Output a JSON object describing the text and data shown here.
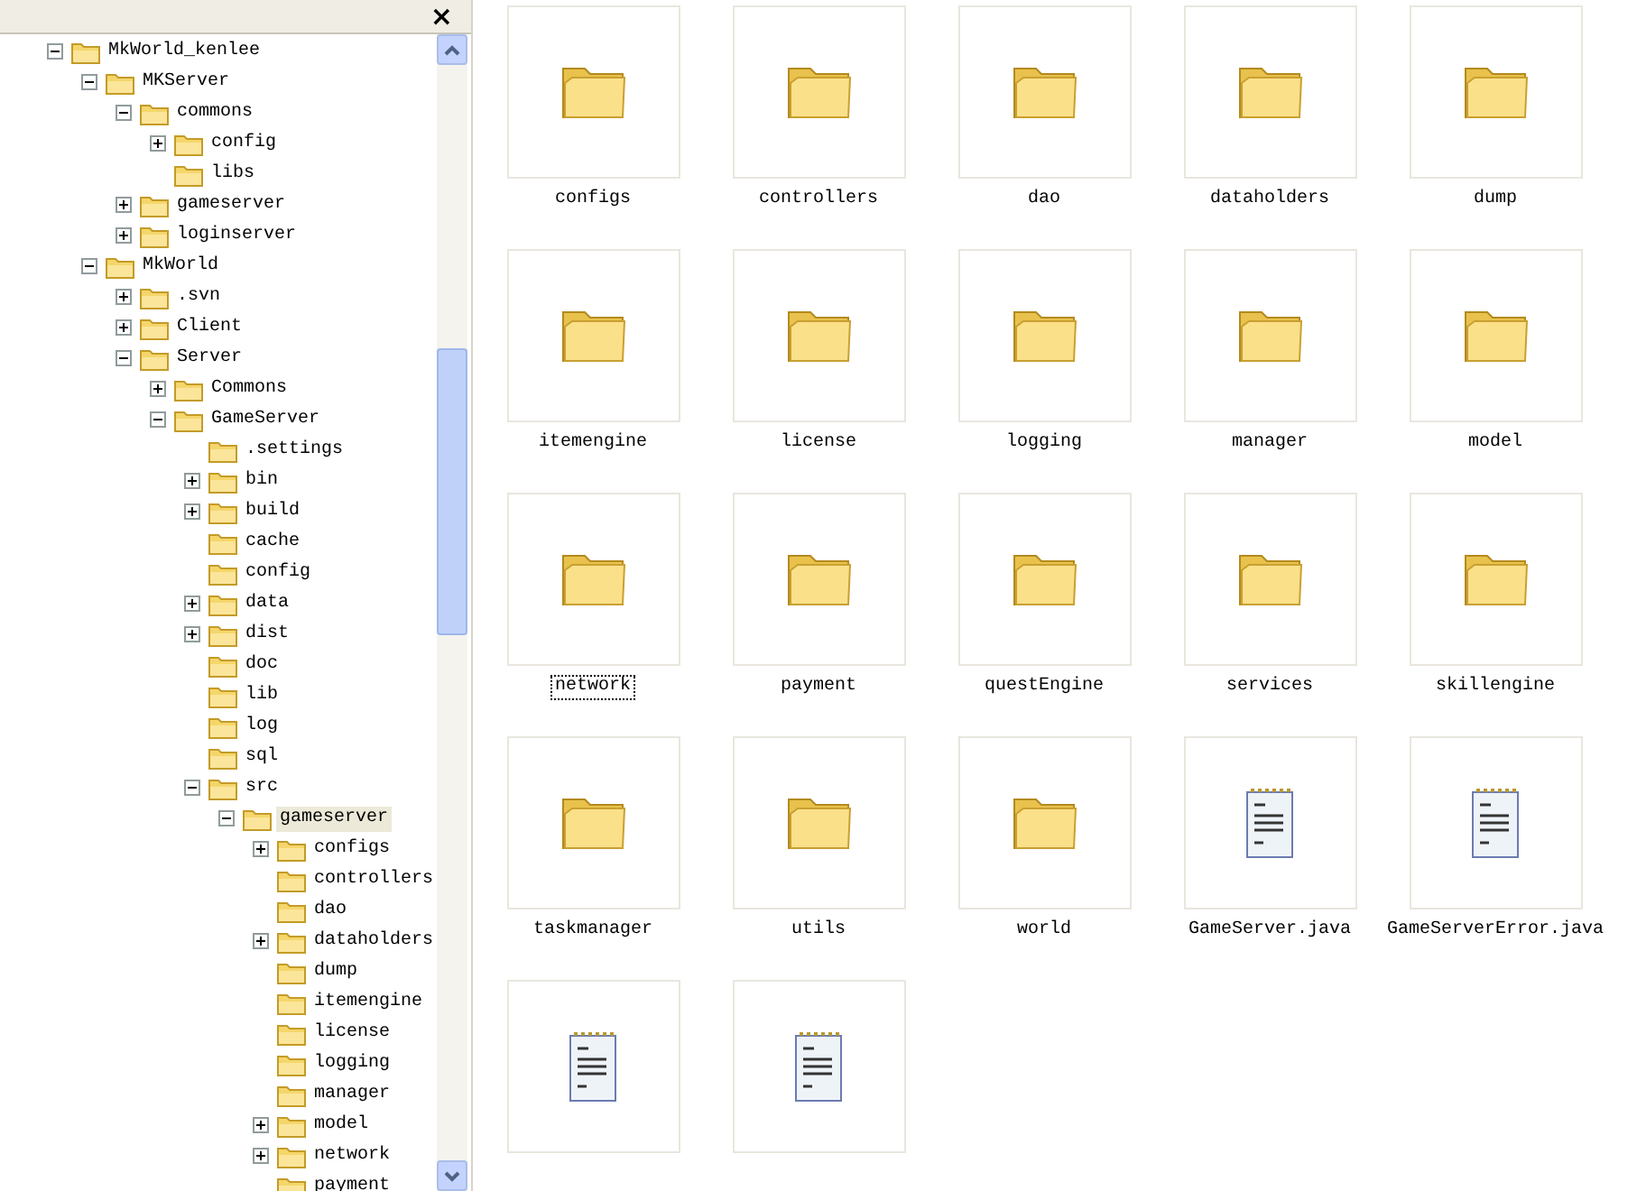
{
  "folders_pane": {
    "close_label": "×",
    "tree": [
      {
        "label": "MkWorld_kenlee",
        "expanded": true,
        "selected": false,
        "children": [
          {
            "label": "MKServer",
            "expanded": true,
            "selected": false,
            "children": [
              {
                "label": "commons",
                "expanded": true,
                "selected": false,
                "children": [
                  {
                    "label": "config",
                    "expanded": false,
                    "selected": false
                  },
                  {
                    "label": "libs",
                    "selected": false
                  }
                ]
              },
              {
                "label": "gameserver",
                "expanded": false,
                "selected": false
              },
              {
                "label": "loginserver",
                "expanded": false,
                "selected": false
              }
            ]
          },
          {
            "label": "MkWorld",
            "expanded": true,
            "selected": false,
            "children": [
              {
                "label": ".svn",
                "expanded": false,
                "selected": false
              },
              {
                "label": "Client",
                "expanded": false,
                "selected": false
              },
              {
                "label": "Server",
                "expanded": true,
                "selected": false,
                "children": [
                  {
                    "label": "Commons",
                    "expanded": false,
                    "selected": false
                  },
                  {
                    "label": "GameServer",
                    "expanded": true,
                    "selected": false,
                    "children": [
                      {
                        "label": ".settings",
                        "selected": false
                      },
                      {
                        "label": "bin",
                        "expanded": false,
                        "selected": false
                      },
                      {
                        "label": "build",
                        "expanded": false,
                        "selected": false
                      },
                      {
                        "label": "cache",
                        "selected": false
                      },
                      {
                        "label": "config",
                        "selected": false
                      },
                      {
                        "label": "data",
                        "expanded": false,
                        "selected": false
                      },
                      {
                        "label": "dist",
                        "expanded": false,
                        "selected": false
                      },
                      {
                        "label": "doc",
                        "selected": false
                      },
                      {
                        "label": "lib",
                        "selected": false
                      },
                      {
                        "label": "log",
                        "selected": false
                      },
                      {
                        "label": "sql",
                        "selected": false
                      },
                      {
                        "label": "src",
                        "expanded": true,
                        "selected": false,
                        "children": [
                          {
                            "label": "gameserver",
                            "expanded": true,
                            "selected": true,
                            "children": [
                              {
                                "label": "configs",
                                "expanded": false,
                                "selected": false
                              },
                              {
                                "label": "controllers",
                                "selected": false
                              },
                              {
                                "label": "dao",
                                "selected": false
                              },
                              {
                                "label": "dataholders",
                                "expanded": false,
                                "selected": false
                              },
                              {
                                "label": "dump",
                                "selected": false
                              },
                              {
                                "label": "itemengine",
                                "selected": false
                              },
                              {
                                "label": "license",
                                "selected": false
                              },
                              {
                                "label": "logging",
                                "selected": false
                              },
                              {
                                "label": "manager",
                                "selected": false
                              },
                              {
                                "label": "model",
                                "expanded": false,
                                "selected": false
                              },
                              {
                                "label": "network",
                                "expanded": false,
                                "selected": false
                              },
                              {
                                "label": "payment",
                                "selected": false
                              }
                            ]
                          }
                        ]
                      }
                    ]
                  }
                ]
              }
            ]
          }
        ]
      }
    ]
  },
  "items": [
    {
      "kind": "folder",
      "label": "configs",
      "focused": false
    },
    {
      "kind": "folder",
      "label": "controllers",
      "focused": false
    },
    {
      "kind": "folder",
      "label": "dao",
      "focused": false
    },
    {
      "kind": "folder",
      "label": "dataholders",
      "focused": false
    },
    {
      "kind": "folder",
      "label": "dump",
      "focused": false
    },
    {
      "kind": "folder",
      "label": "itemengine",
      "focused": false
    },
    {
      "kind": "folder",
      "label": "license",
      "focused": false
    },
    {
      "kind": "folder",
      "label": "logging",
      "focused": false
    },
    {
      "kind": "folder",
      "label": "manager",
      "focused": false
    },
    {
      "kind": "folder",
      "label": "model",
      "focused": false
    },
    {
      "kind": "folder",
      "label": "network",
      "focused": true
    },
    {
      "kind": "folder",
      "label": "payment",
      "focused": false
    },
    {
      "kind": "folder",
      "label": "questEngine",
      "focused": false
    },
    {
      "kind": "folder",
      "label": "services",
      "focused": false
    },
    {
      "kind": "folder",
      "label": "skillengine",
      "focused": false
    },
    {
      "kind": "folder",
      "label": "taskmanager",
      "focused": false
    },
    {
      "kind": "folder",
      "label": "utils",
      "focused": false
    },
    {
      "kind": "folder",
      "label": "world",
      "focused": false
    },
    {
      "kind": "file",
      "label": "GameServer.java",
      "focused": false
    },
    {
      "kind": "file",
      "label": "GameServerError.java",
      "focused": false
    },
    {
      "kind": "file"
    },
    {
      "kind": "file"
    }
  ]
}
